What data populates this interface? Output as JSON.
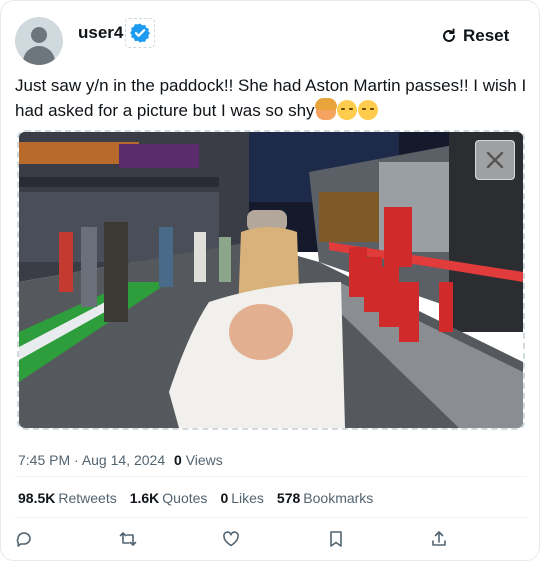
{
  "user": {
    "name": "user4",
    "verified": true
  },
  "header": {
    "reset_label": "Reset"
  },
  "tweet": {
    "text": "Just saw y/n in the paddock!! She had Aston Martin passes!! I wish I had asked for a picture but I was so shy",
    "emojis": [
      "person-blonde-emoji",
      "sad-relieved-face-emoji",
      "shy-face-emoji"
    ]
  },
  "media": {
    "description": "photo",
    "close_icon": "close-icon"
  },
  "meta": {
    "time": "7:45 PM",
    "separator": " · ",
    "date": "Aug 14, 2024",
    "views_count": "0",
    "views_label": "Views"
  },
  "stats": {
    "retweets_count": "98.5K",
    "retweets_label": "Retweets",
    "quotes_count": "1.6K",
    "quotes_label": "Quotes",
    "likes_count": "0",
    "likes_label": "Likes",
    "bookmarks_count": "578",
    "bookmarks_label": "Bookmarks"
  },
  "actions": [
    "reply-icon",
    "retweet-icon",
    "like-icon",
    "bookmark-icon",
    "share-icon"
  ],
  "colors": {
    "verified_blue": "#1d9bf0",
    "text": "#0f1419",
    "secondary": "#536471",
    "divider": "#eff3f4"
  }
}
